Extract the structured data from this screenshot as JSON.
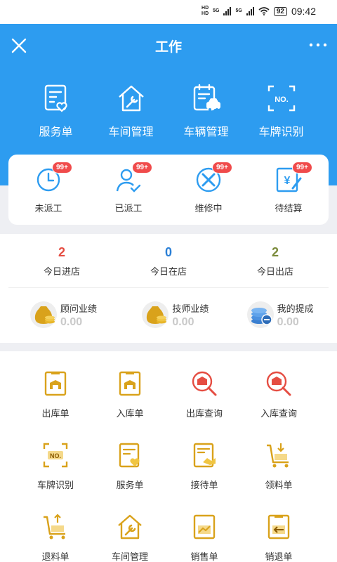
{
  "status_bar": {
    "hd1": "HD",
    "hd2": "HD",
    "net1": "5G",
    "net2": "5G",
    "battery": "92",
    "time": "09:42"
  },
  "header": {
    "title": "工作"
  },
  "quick_actions": [
    {
      "label": "服务单",
      "icon": "service-order-icon"
    },
    {
      "label": "车间管理",
      "icon": "workshop-icon"
    },
    {
      "label": "车辆管理",
      "icon": "vehicle-icon"
    },
    {
      "label": "车牌识别",
      "icon": "plate-scan-icon"
    }
  ],
  "order_status": [
    {
      "label": "未派工",
      "badge": "99+"
    },
    {
      "label": "已派工",
      "badge": "99+"
    },
    {
      "label": "维修中",
      "badge": "99+"
    },
    {
      "label": "待结算",
      "badge": "99+"
    }
  ],
  "counts": [
    {
      "value": "2",
      "label": "今日进店",
      "color": "#e54d42"
    },
    {
      "value": "0",
      "label": "今日在店",
      "color": "#2a7fd6"
    },
    {
      "value": "2",
      "label": "今日出店",
      "color": "#7a8a3a"
    }
  ],
  "performance": [
    {
      "label": "顾问业绩",
      "value": "0.00"
    },
    {
      "label": "技师业绩",
      "value": "0.00"
    },
    {
      "label": "我的提成",
      "value": "0.00"
    }
  ],
  "functions": [
    {
      "label": "出库单"
    },
    {
      "label": "入库单"
    },
    {
      "label": "出库查询"
    },
    {
      "label": "入库查询"
    },
    {
      "label": "车牌识别"
    },
    {
      "label": "服务单"
    },
    {
      "label": "接待单"
    },
    {
      "label": "领料单"
    },
    {
      "label": "退料单"
    },
    {
      "label": "车间管理"
    },
    {
      "label": "销售单"
    },
    {
      "label": "销退单"
    }
  ],
  "colors": {
    "primary": "#2d9cf0",
    "gold": "#d9a21b",
    "red": "#e54d42"
  }
}
